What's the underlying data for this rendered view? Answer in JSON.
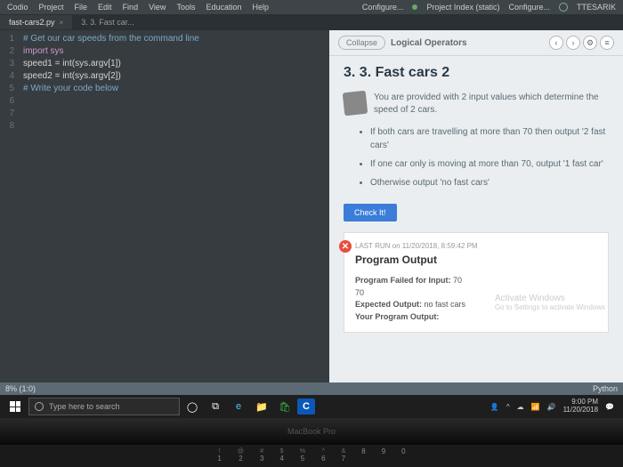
{
  "menubar": {
    "items": [
      "Codio",
      "Project",
      "File",
      "Edit",
      "Find",
      "View",
      "Tools",
      "Education",
      "Help"
    ],
    "right": [
      "Configure...",
      "Project Index (static)",
      "Configure...",
      "TTESARIK"
    ]
  },
  "tabs": {
    "active": "fast-cars2.py",
    "second": "3. 3. Fast car..."
  },
  "code": {
    "lines": [
      "",
      "# Get our car speeds from the command line",
      "import sys",
      "speed1 = int(sys.argv[1])",
      "speed2 = int(sys.argv[2])",
      "",
      "# Write your code below",
      ""
    ],
    "nums": [
      "1",
      "2",
      "3",
      "4",
      "5",
      "6",
      "7",
      "8"
    ]
  },
  "status": {
    "left": "8% (1:0)",
    "right": "Python"
  },
  "panel": {
    "collapse": "Collapse",
    "crumb": "Logical Operators",
    "title": "3. 3. Fast cars 2",
    "intro": "You are provided with 2 input values which determine the speed of 2 cars.",
    "rules": [
      "If both cars are travelling at more than 70 then output '2 fast cars'",
      "If one car only is moving at more than 70, output '1 fast car'",
      "Otherwise output 'no fast cars'"
    ],
    "check": "Check It!",
    "lastrun": "LAST RUN on 11/20/2018, 8:59:42 PM",
    "progout": "Program Output",
    "fail1": "Program Failed for Input:",
    "failinput": "70",
    "failinput2": "70",
    "exp": "Expected Output:",
    "expval": "no fast cars",
    "your": "Your Program Output:"
  },
  "activate": {
    "t": "Activate Windows",
    "s": "Go to Settings to activate Windows"
  },
  "taskbar": {
    "search": "Type here to search"
  },
  "clock": {
    "time": "9:00 PM",
    "date": "11/20/2018"
  },
  "mac": "MacBook Pro",
  "keys": [
    [
      "!",
      "1"
    ],
    [
      "@",
      "2"
    ],
    [
      "#",
      "3"
    ],
    [
      "$",
      "4"
    ],
    [
      "%",
      "5"
    ],
    [
      "^",
      "6"
    ],
    [
      "&",
      "7"
    ],
    [
      "",
      "8"
    ],
    [
      "",
      "9"
    ],
    [
      "",
      "0"
    ]
  ]
}
